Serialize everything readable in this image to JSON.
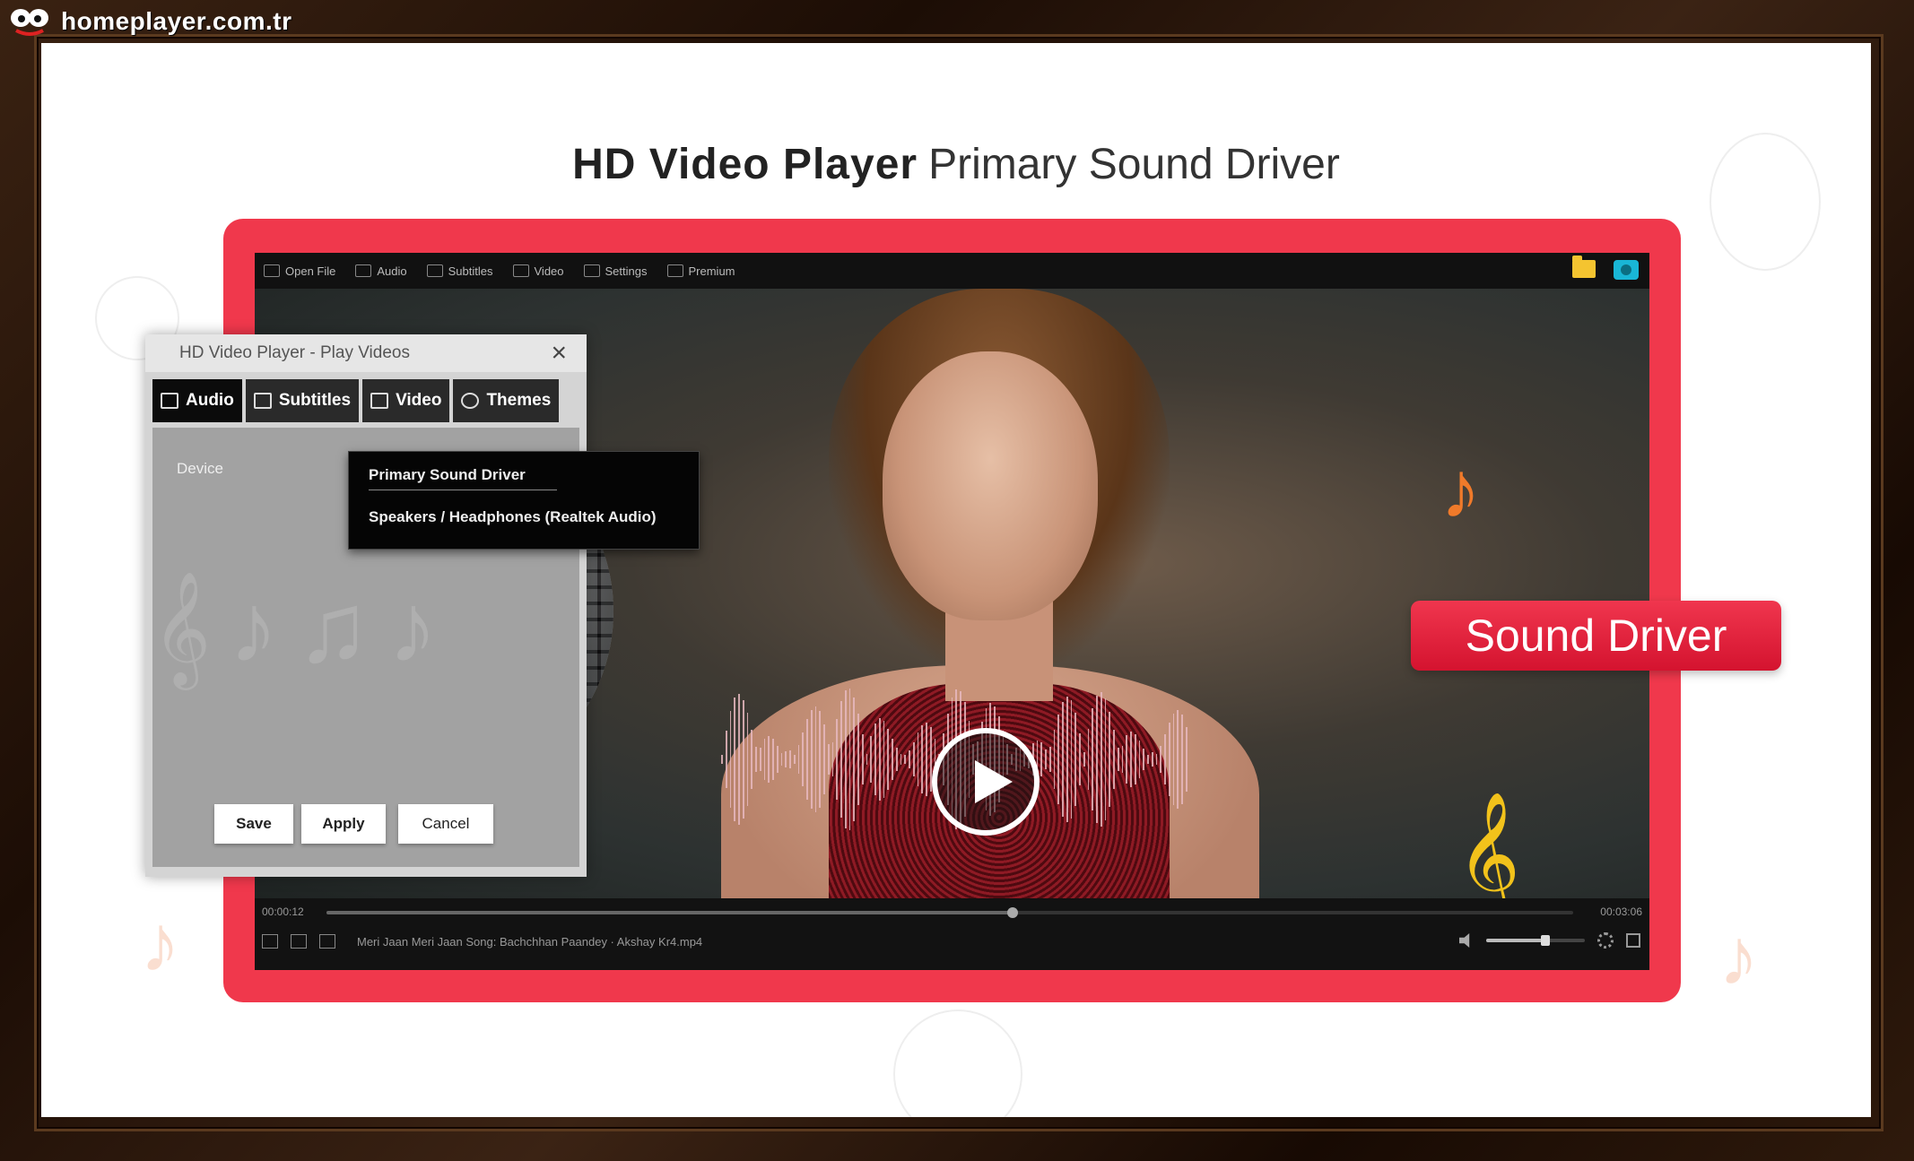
{
  "site": {
    "name": "homeplayer.com.tr"
  },
  "headline": {
    "bold": "HD Video Player",
    "light": "Primary Sound Driver"
  },
  "player": {
    "menu": [
      "Open File",
      "Audio",
      "Subtitles",
      "Video",
      "Settings",
      "Premium"
    ],
    "time_elapsed": "00:00:12",
    "time_total": "00:03:06",
    "seek_progress": 0.55,
    "volume_level": 0.6,
    "filename": "Meri Jaan Meri Jaan Song: Bachchhan Paandey · Akshay Kr4.mp4"
  },
  "badge": {
    "label": "Sound Driver"
  },
  "dialog": {
    "title": "HD Video Player - Play Videos",
    "close": "×",
    "tabs": [
      {
        "label": "Audio",
        "icon": "speaker-icon"
      },
      {
        "label": "Subtitles",
        "icon": "subtitles-icon"
      },
      {
        "label": "Video",
        "icon": "camera-icon"
      },
      {
        "label": "Themes",
        "icon": "palette-icon"
      }
    ],
    "device_label": "Device",
    "buttons": {
      "save": "Save",
      "apply": "Apply",
      "cancel": "Cancel"
    }
  },
  "dropdown": {
    "options": [
      "Primary Sound Driver",
      "Speakers / Headphones (Realtek Audio)"
    ]
  },
  "colors": {
    "accent": "#f0384c",
    "badge": "#e01f38",
    "frame": "#2a160c"
  }
}
